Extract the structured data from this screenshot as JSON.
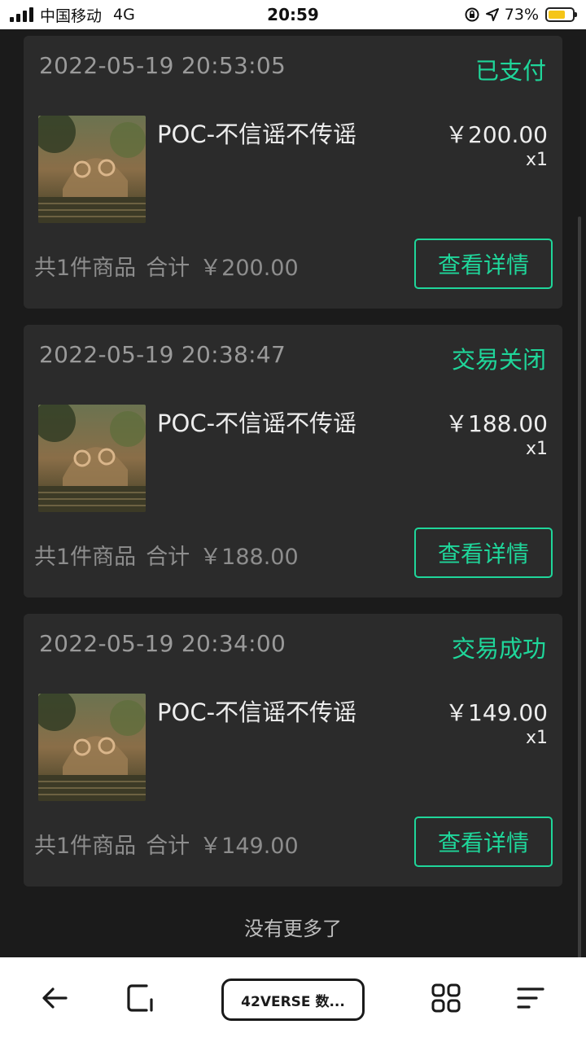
{
  "status_bar": {
    "carrier": "中国移动",
    "network": "4G",
    "time": "20:59",
    "battery": "73%",
    "battery_level": 0.73
  },
  "orders": [
    {
      "time": "2022-05-19 20:53:05",
      "status": "已支付",
      "product_name": "POC-不信谣不传谣",
      "price": "￥200.00",
      "quantity": "x1",
      "count_text": "共1件商品",
      "total_label": "合计",
      "total": "￥200.00",
      "detail_label": "查看详情"
    },
    {
      "time": "2022-05-19 20:38:47",
      "status": "交易关闭",
      "product_name": "POC-不信谣不传谣",
      "price": "￥188.00",
      "quantity": "x1",
      "count_text": "共1件商品",
      "total_label": "合计",
      "total": "￥188.00",
      "detail_label": "查看详情"
    },
    {
      "time": "2022-05-19 20:34:00",
      "status": "交易成功",
      "product_name": "POC-不信谣不传谣",
      "price": "￥149.00",
      "quantity": "x1",
      "count_text": "共1件商品",
      "total_label": "合计",
      "total": "￥149.00",
      "detail_label": "查看详情"
    }
  ],
  "no_more_text": "没有更多了",
  "toolbar": {
    "tab_label": "42VERSE 数...",
    "icons": [
      "back-arrow-icon",
      "tab-switch-icon",
      "grid-icon",
      "menu-lines-icon"
    ]
  },
  "colors": {
    "accent": "#1fd69a",
    "card_bg": "#2b2b2b",
    "page_bg": "#1b1b1b"
  }
}
